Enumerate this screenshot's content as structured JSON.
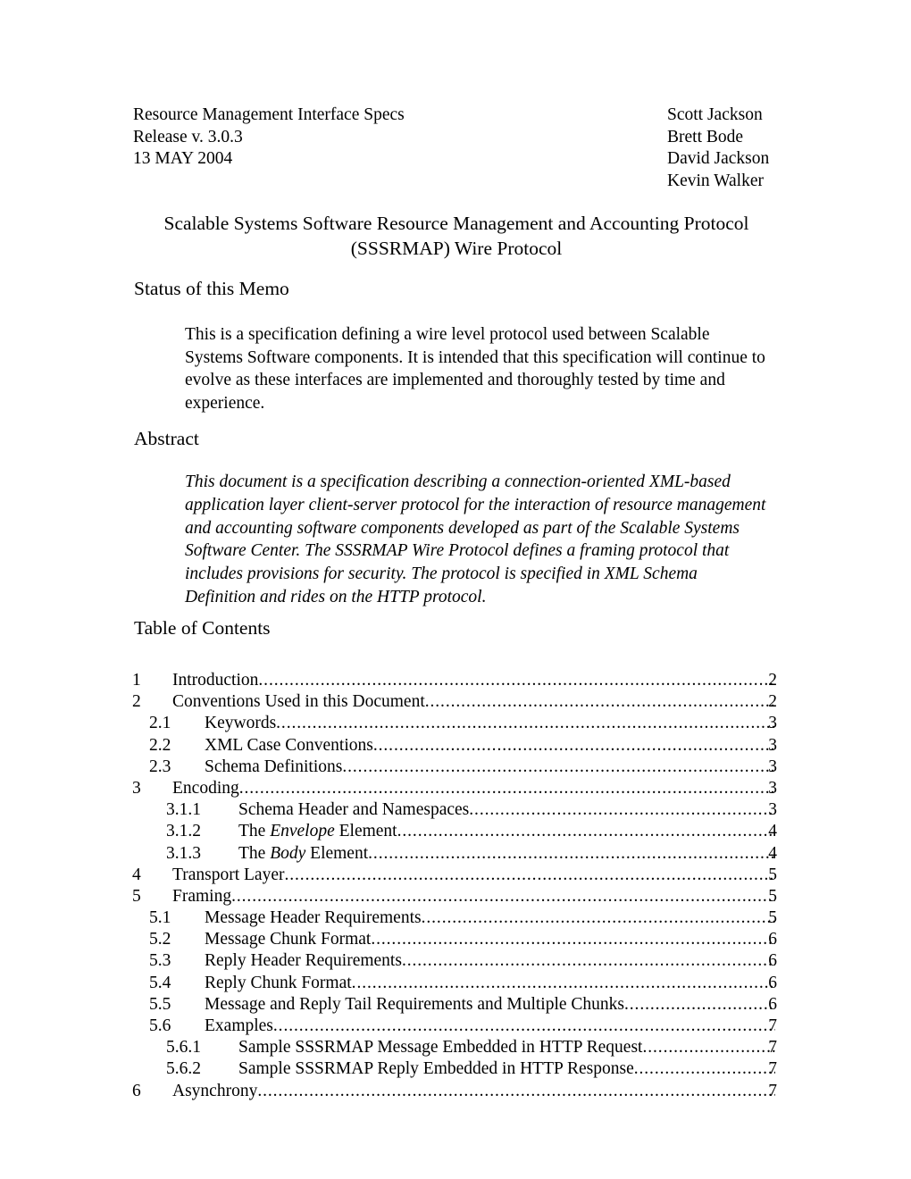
{
  "header": {
    "left_lines": [
      "Resource Management Interface Specs",
      "Release v. 3.0.3",
      "13 MAY 2004"
    ],
    "authors": [
      "Scott Jackson",
      "Brett Bode",
      "David Jackson",
      "Kevin Walker"
    ]
  },
  "title": {
    "line1": "Scalable Systems Software Resource Management and Accounting Protocol",
    "line2": "(SSSRMAP) Wire Protocol"
  },
  "sections": {
    "status_heading": "Status of this Memo",
    "status_text": "This is a specification defining a wire level protocol used between Scalable Systems Software components. It is intended that this specification will continue to evolve as these interfaces are implemented and thoroughly tested by time and experience.",
    "abstract_heading": "Abstract",
    "abstract_text": "This document is a specification describing a connection-oriented XML-based application layer client-server protocol for the interaction of resource management and accounting software components developed as part of the Scalable Systems Software Center. The SSSRMAP Wire Protocol defines a framing protocol that includes provisions for security. The protocol is specified in XML Schema Definition and rides on the HTTP protocol.",
    "toc_heading": "Table of Contents"
  },
  "toc": {
    "leader_char": ".",
    "entries": [
      {
        "level": 1,
        "number": "1",
        "label": "Introduction",
        "page": "2"
      },
      {
        "level": 1,
        "number": "2",
        "label": "Conventions Used in this Document",
        "page": "2"
      },
      {
        "level": 2,
        "number": "2.1",
        "label": "Keywords",
        "page": "3"
      },
      {
        "level": 2,
        "number": "2.2",
        "label": "XML Case Conventions",
        "page": "3"
      },
      {
        "level": 2,
        "number": "2.3",
        "label": "Schema Definitions",
        "page": "3"
      },
      {
        "level": 1,
        "number": "3",
        "label": "Encoding",
        "page": "3"
      },
      {
        "level": 3,
        "number": "3.1.1",
        "label": "Schema Header and Namespaces",
        "page": "3"
      },
      {
        "level": 3,
        "number": "3.1.2",
        "label": "The Envelope Element",
        "italic": "Envelope",
        "page": "4"
      },
      {
        "level": 3,
        "number": "3.1.3",
        "label": "The Body Element",
        "italic": "Body",
        "page": "4"
      },
      {
        "level": 1,
        "number": "4",
        "label": "Transport Layer",
        "page": "5"
      },
      {
        "level": 1,
        "number": "5",
        "label": "Framing",
        "page": "5"
      },
      {
        "level": 2,
        "number": "5.1",
        "label": "Message Header Requirements",
        "page": "5"
      },
      {
        "level": 2,
        "number": "5.2",
        "label": "Message Chunk Format",
        "page": "6"
      },
      {
        "level": 2,
        "number": "5.3",
        "label": "Reply Header Requirements",
        "page": "6"
      },
      {
        "level": 2,
        "number": "5.4",
        "label": "Reply Chunk Format",
        "page": "6"
      },
      {
        "level": 2,
        "number": "5.5",
        "label": "Message and Reply Tail Requirements and Multiple Chunks",
        "page": "6"
      },
      {
        "level": 2,
        "number": "5.6",
        "label": "Examples",
        "page": "7"
      },
      {
        "level": 3,
        "number": "5.6.1",
        "label": "Sample SSSRMAP Message Embedded in HTTP Request",
        "page": "7"
      },
      {
        "level": 3,
        "number": "5.6.2",
        "label": "Sample SSSRMAP Reply Embedded in HTTP Response",
        "page": "7"
      },
      {
        "level": 1,
        "number": "6",
        "label": "Asynchrony",
        "page": "7"
      }
    ]
  }
}
